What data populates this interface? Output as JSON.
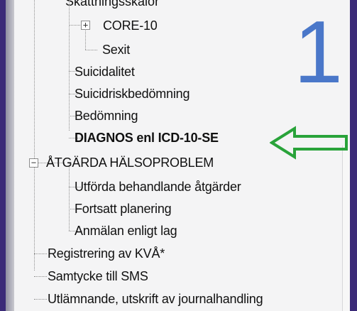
{
  "tree": {
    "partial_top_label": "Skattningsskalor",
    "items": [
      {
        "label": "CORE-10",
        "expand_symbol": "+"
      },
      {
        "label": "Sexit"
      },
      {
        "label": "Suicidalitet"
      },
      {
        "label": "Suicidriskbedömning"
      },
      {
        "label": "Bedömning"
      },
      {
        "label": "DIAGNOS enl ICD-10-SE"
      },
      {
        "label": "ÅTGÄRDA HÄLSOPROBLEM",
        "expand_symbol": "−"
      },
      {
        "label": "Utförda behandlande åtgärder"
      },
      {
        "label": "Fortsatt planering"
      },
      {
        "label": "Anmälan enligt lag"
      },
      {
        "label": "Registrering av KVÅ*"
      },
      {
        "label": "Samtycke till SMS"
      },
      {
        "label": "Utlämnande, utskrift av journalhandling"
      }
    ]
  },
  "annotation": {
    "number": "1",
    "arrow_color": "#29a33a"
  },
  "colors": {
    "background": "#3f2f7c",
    "panel": "#f4f4f5",
    "number": "#4a77c9"
  }
}
